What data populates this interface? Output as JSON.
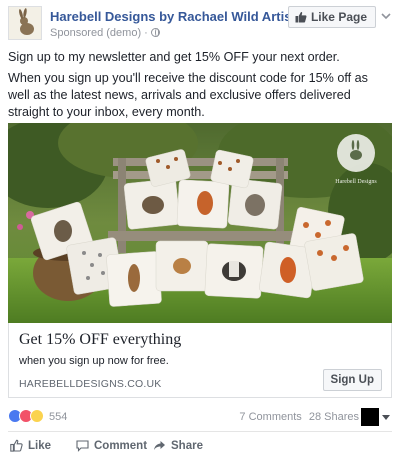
{
  "post": {
    "page_name": "Harebell Designs by Rachael Wild Artist",
    "sponsored": "Sponsored (demo)",
    "separator": "·",
    "like_page_label": "Like Page",
    "text_lines": [
      "Sign up to my newsletter and get 15% OFF your next order.",
      "When you sign up you'll receive the discount code for 15% off as well as the latest news, arrivals and exclusive offers delivered straight to your inbox, every month."
    ]
  },
  "ad": {
    "brand_mark": "Harebell Designs",
    "headline": "Get 15% OFF everything",
    "description": "when you sign up now for free.",
    "domain": "HAREBELLDESIGNS.CO.UK",
    "cta_label": "Sign Up"
  },
  "engagement": {
    "reaction_count": "554",
    "comments": "7 Comments",
    "shares": "28 Shares",
    "reaction_icons": [
      "like-reaction-icon",
      "love-reaction-icon",
      "wow-reaction-icon"
    ]
  },
  "actions": {
    "like": "Like",
    "comment": "Comment",
    "share": "Share"
  },
  "colors": {
    "link_blue": "#365899",
    "meta_gray": "#90949c",
    "like_blue": "#4a79f0",
    "love_red": "#f25268",
    "wow_yellow": "#fbd34f"
  }
}
